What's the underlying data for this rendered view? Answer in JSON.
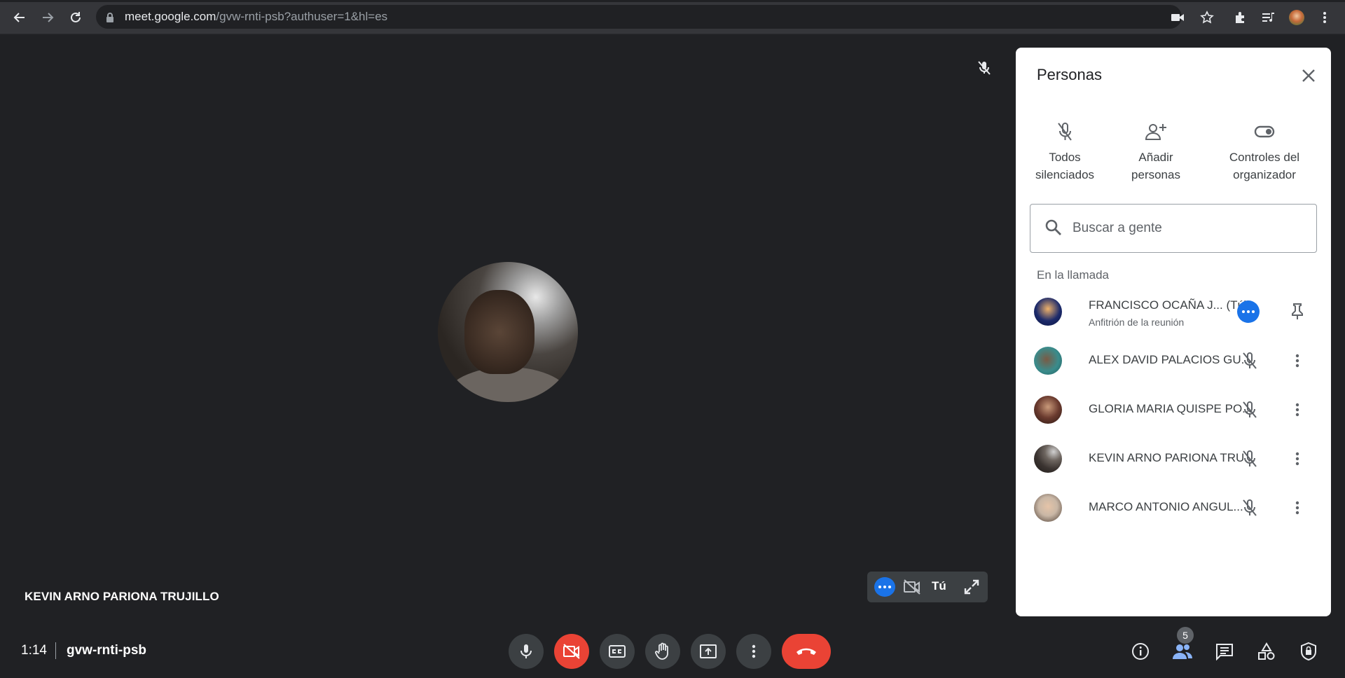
{
  "browser": {
    "url_host": "meet.google.com",
    "url_path": "/gvw-rnti-psb?authuser=1&hl=es"
  },
  "stage": {
    "speaker_name": "KEVIN ARNO PARIONA TRUJILLO",
    "self_label": "Tú"
  },
  "meeting": {
    "time": "1:14",
    "code": "gvw-rnti-psb",
    "participants_count": "5"
  },
  "panel": {
    "title": "Personas",
    "actions": [
      {
        "line1": "Todos",
        "line2": "silenciados"
      },
      {
        "line1": "Añadir",
        "line2": "personas"
      },
      {
        "line1": "Controles del",
        "line2": "organizador"
      }
    ],
    "search_placeholder": "Buscar a gente",
    "section_label": "En la llamada",
    "people": [
      {
        "name": "FRANCISCO OCAÑA J...",
        "tag": "(Tú)",
        "sub": "Anfitrión de la reunión",
        "avatar_color": "#1c2a6b"
      },
      {
        "name": "ALEX DAVID PALACIOS GU...",
        "avatar_color": "#3a8c8c"
      },
      {
        "name": "GLORIA MARIA QUISPE PO...",
        "avatar_color": "#6b3b2f"
      },
      {
        "name": "KEVIN ARNO PARIONA TRU...",
        "avatar_color": "#3b3431"
      },
      {
        "name": "MARCO ANTONIO ANGUL...",
        "avatar_color": "#c9b7a6"
      }
    ]
  },
  "colors": {
    "accent": "#1a73e8",
    "danger": "#ea4335",
    "background": "#202124"
  }
}
